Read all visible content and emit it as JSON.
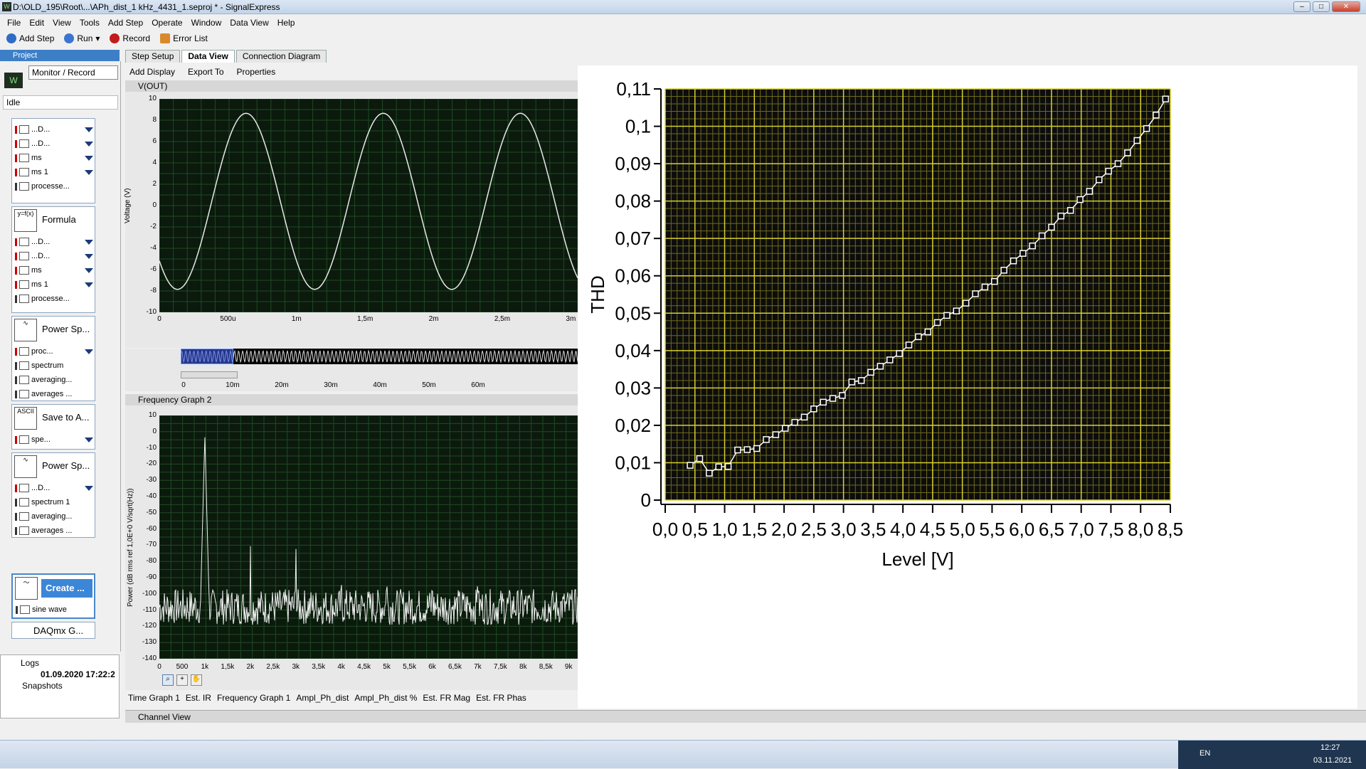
{
  "window": {
    "title": "D:\\OLD_195\\Root\\...\\APh_dist_1 kHz_4431_1.seproj * - SignalExpress"
  },
  "menu": [
    "File",
    "Edit",
    "View",
    "Tools",
    "Add Step",
    "Operate",
    "Window",
    "Data View",
    "Help"
  ],
  "toolbar": {
    "add_step": "Add Step",
    "run": "Run",
    "record": "Record",
    "error_list": "Error List"
  },
  "project": {
    "header": "Project",
    "mode": "Monitor / Record",
    "status": "Idle",
    "steps": [
      {
        "title": "",
        "rows": [
          "...D...",
          "...D...",
          "ms",
          "ms 1",
          "processe..."
        ]
      },
      {
        "title": "Formula",
        "rows": [
          "...D...",
          "...D...",
          "ms",
          "ms 1",
          "processe..."
        ]
      },
      {
        "title": "Power Sp...",
        "rows": [
          "proc...",
          "spectrum",
          "averaging...",
          "averages ..."
        ]
      },
      {
        "title": "Save to A...",
        "rows": [
          "spe..."
        ]
      },
      {
        "title": "Power Sp...",
        "rows": [
          "...D...",
          "spectrum 1",
          "averaging...",
          "averages ..."
        ]
      },
      {
        "title": "Create ...",
        "rows": [
          "sine wave"
        ]
      },
      {
        "title": "DAQmx G...",
        "rows": []
      }
    ],
    "logs": {
      "label": "Logs",
      "entry": "01.09.2020 17:22:2",
      "snapshots": "Snapshots"
    }
  },
  "tabs": {
    "step_setup": "Step Setup",
    "data_view": "Data View",
    "connection_diagram": "Connection Diagram"
  },
  "subtoolbar": {
    "add_display": "Add Display",
    "export_to": "Export To",
    "properties": "Properties"
  },
  "time_graph": {
    "title": "V(OUT)",
    "ylabel": "Voltage (V)",
    "yticks": [
      "10",
      "8",
      "6",
      "4",
      "2",
      "0",
      "-2",
      "-4",
      "-6",
      "-8",
      "-10"
    ],
    "xticks": [
      "0",
      "500u",
      "1m",
      "1,5m",
      "2m",
      "2,5m",
      "3m"
    ],
    "overview_ticks": [
      "0",
      "10m",
      "20m",
      "30m",
      "40m",
      "50m",
      "60m"
    ]
  },
  "freq_graph": {
    "title": "Frequency Graph 2",
    "ylabel": "Power (dB rms ref 1,0E+0 V/sqrt(Hz))",
    "yticks": [
      "10",
      "0",
      "-10",
      "-20",
      "-30",
      "-40",
      "-50",
      "-60",
      "-70",
      "-80",
      "-90",
      "-100",
      "-110",
      "-120",
      "-130",
      "-140"
    ],
    "xticks": [
      "0",
      "500",
      "1k",
      "1,5k",
      "2k",
      "2,5k",
      "3k",
      "3,5k",
      "4k",
      "4,5k",
      "5k",
      "5,5k",
      "6k",
      "6,5k",
      "7k",
      "7,5k",
      "8k",
      "8,5k",
      "9k"
    ]
  },
  "bottom_tabs": [
    "Time Graph 1",
    "Est. IR",
    "Frequency Graph 1",
    "Ampl_Ph_dist",
    "Ampl_Ph_dist %",
    "Est. FR Mag",
    "Est. FR Phas"
  ],
  "channel_view": "Channel View",
  "chart_data": {
    "type": "line",
    "xlabel": "Level [V]",
    "ylabel": "THD",
    "xlim": [
      0,
      8.5
    ],
    "ylim": [
      0,
      0.11
    ],
    "xticks": [
      "0,0",
      "0,5",
      "1,0",
      "1,5",
      "2,0",
      "2,5",
      "3,0",
      "3,5",
      "4,0",
      "4,5",
      "5,0",
      "5,5",
      "6,0",
      "6,5",
      "7,0",
      "7,5",
      "8,0",
      "8,5"
    ],
    "yticks": [
      "0",
      "0,01",
      "0,02",
      "0,03",
      "0,04",
      "0,05",
      "0,06",
      "0,07",
      "0,08",
      "0,09",
      "0,1",
      "0,11"
    ],
    "grid": true,
    "x": [
      0.42,
      0.58,
      0.74,
      0.9,
      1.06,
      1.22,
      1.38,
      1.54,
      1.7,
      1.86,
      2.02,
      2.18,
      2.34,
      2.5,
      2.66,
      2.82,
      2.98,
      3.14,
      3.3,
      3.46,
      3.62,
      3.78,
      3.94,
      4.1,
      4.26,
      4.42,
      4.58,
      4.74,
      4.9,
      5.06,
      5.22,
      5.38,
      5.54,
      5.7,
      5.86,
      6.02,
      6.18,
      6.34,
      6.5,
      6.66,
      6.82,
      6.98,
      7.14,
      7.3,
      7.46,
      7.62,
      7.78,
      7.94,
      8.1,
      8.26,
      8.42
    ],
    "y": [
      0.0093,
      0.0111,
      0.0072,
      0.0089,
      0.009,
      0.0134,
      0.0135,
      0.0138,
      0.0162,
      0.0175,
      0.0192,
      0.0208,
      0.0222,
      0.0244,
      0.0262,
      0.0272,
      0.028,
      0.0316,
      0.032,
      0.0342,
      0.0358,
      0.0375,
      0.0392,
      0.0415,
      0.0437,
      0.045,
      0.0475,
      0.0494,
      0.0506,
      0.0527,
      0.0552,
      0.057,
      0.0585,
      0.0615,
      0.064,
      0.066,
      0.068,
      0.0707,
      0.073,
      0.076,
      0.0775,
      0.0804,
      0.0826,
      0.0857,
      0.088,
      0.09,
      0.0929,
      0.0962,
      0.0994,
      0.103,
      0.1073
    ]
  },
  "tray": {
    "lang": "EN",
    "time": "12:27",
    "date": "03.11.2021"
  }
}
